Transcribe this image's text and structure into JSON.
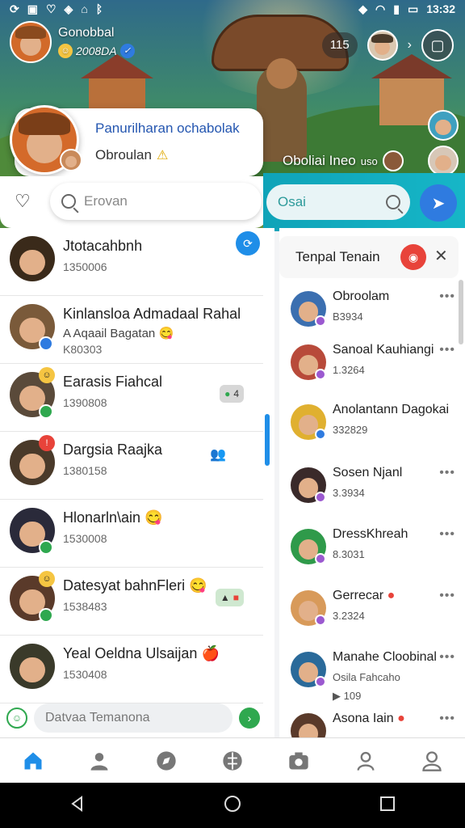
{
  "status_bar": {
    "time": "13:32"
  },
  "profile": {
    "name": "Gonobbal",
    "score": "2008DA"
  },
  "header": {
    "badge": "115",
    "hero_caption": "Oboliai Ineo",
    "hero_caption_suffix": "uso"
  },
  "popup": {
    "title": "Panurilharan ochabolak",
    "subtitle": "Obroulan"
  },
  "search": {
    "placeholder": "Erovan"
  },
  "right_search": {
    "placeholder": "Osai"
  },
  "chats": [
    {
      "name": "Jtotacahbnh",
      "meta": "1350006",
      "avatar_color": "#3a2a1a"
    },
    {
      "name": "Kinlansloa Admadaal Rahal",
      "sub": "A Aqaail Bagatan",
      "meta": "K80303",
      "avatar_color": "#7a5a3a"
    },
    {
      "name": "Earasis Fiahcal",
      "meta": "1390808",
      "badge": "4",
      "avatar_color": "#5a4a3a"
    },
    {
      "name": "Dargsia Raajka",
      "meta": "1380158",
      "avatar_color": "#4a3a2a"
    },
    {
      "name": "Hlonarln\\ain",
      "meta": "1530008",
      "avatar_color": "#2a2a3a"
    },
    {
      "name": "Datesyat bahnFleri",
      "meta": "1538483",
      "badge": "▲",
      "avatar_color": "#5a3a2a"
    },
    {
      "name": "Yeal Oeldna Ulsaijan",
      "meta": "1530408",
      "avatar_color": "#3a3a2a"
    }
  ],
  "compose": {
    "placeholder": "Datvaa Temanona"
  },
  "friends_panel": {
    "title": "Tenpal Tenain",
    "items": [
      {
        "name": "Obroolam",
        "meta": "B3934",
        "dot": "#9b59d0",
        "avatar_color": "#3b6fb0"
      },
      {
        "name": "Sanoal Kauhiangi",
        "meta": "1.3264",
        "dot": "#9b59d0",
        "avatar_color": "#b84a3a"
      },
      {
        "name": "Anolantann Dagokai",
        "meta": "332829",
        "dot": "#2f7be0",
        "avatar_color": "#e0b030"
      },
      {
        "name": "Sosen Njanl",
        "meta": "3.3934",
        "dot": "#9b59d0",
        "avatar_color": "#3a2a2a"
      },
      {
        "name": "DressKhreah",
        "meta": "8.3031",
        "dot": "#9b59d0",
        "avatar_color": "#2f9a4a"
      },
      {
        "name": "Gerrecar",
        "meta": "3.2324",
        "dot": "#9b59d0",
        "avatar_color": "#d89a5a"
      },
      {
        "name": "Manahe Cloobinal",
        "sub": "Osila Fahcaho",
        "meta": "109",
        "dot": "#9b59d0",
        "avatar_color": "#2a6a9a"
      },
      {
        "name": "Asona Iain",
        "dot": "#2f7be0",
        "avatar_color": "#5a3a2a"
      }
    ]
  },
  "nav": [
    "home-icon",
    "person-icon",
    "compass-icon",
    "globe-icon",
    "camera-icon",
    "profile-icon",
    "account-icon"
  ],
  "colors": {
    "accent": "#1f8ee8",
    "teal": "#16b6c7"
  }
}
